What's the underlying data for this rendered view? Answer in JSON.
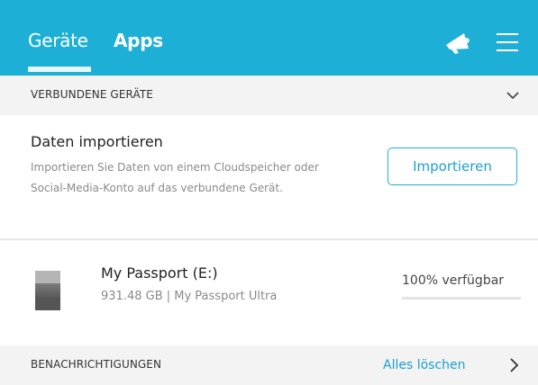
{
  "header": {
    "tabs": [
      {
        "label": "Geräte",
        "active": true
      },
      {
        "label": "Apps",
        "active": false
      }
    ],
    "icons": [
      "megaphone-icon",
      "menu-icon"
    ],
    "background_color": "#1dafd6"
  },
  "connected_devices": {
    "section_label": "VERBUNDENE GERÄTE",
    "import": {
      "title": "Daten importieren",
      "description": "Importieren Sie Daten von einem Cloudspeicher oder Social-Media-Konto auf das verbundene Gerät.",
      "button_label": "Importieren"
    },
    "drive": {
      "name": "My Passport (E:)",
      "details": "931.48 GB | My Passport Ultra",
      "availability_label": "100% verfügbar",
      "available_fraction": 1.0
    }
  },
  "notifications": {
    "section_label": "BENACHRICHTIGUNGEN",
    "clear_all_label": "Alles löschen"
  },
  "colors": {
    "accent": "#1dafd6",
    "link": "#1a9fd0",
    "section_bar": "#f3f3f3"
  }
}
